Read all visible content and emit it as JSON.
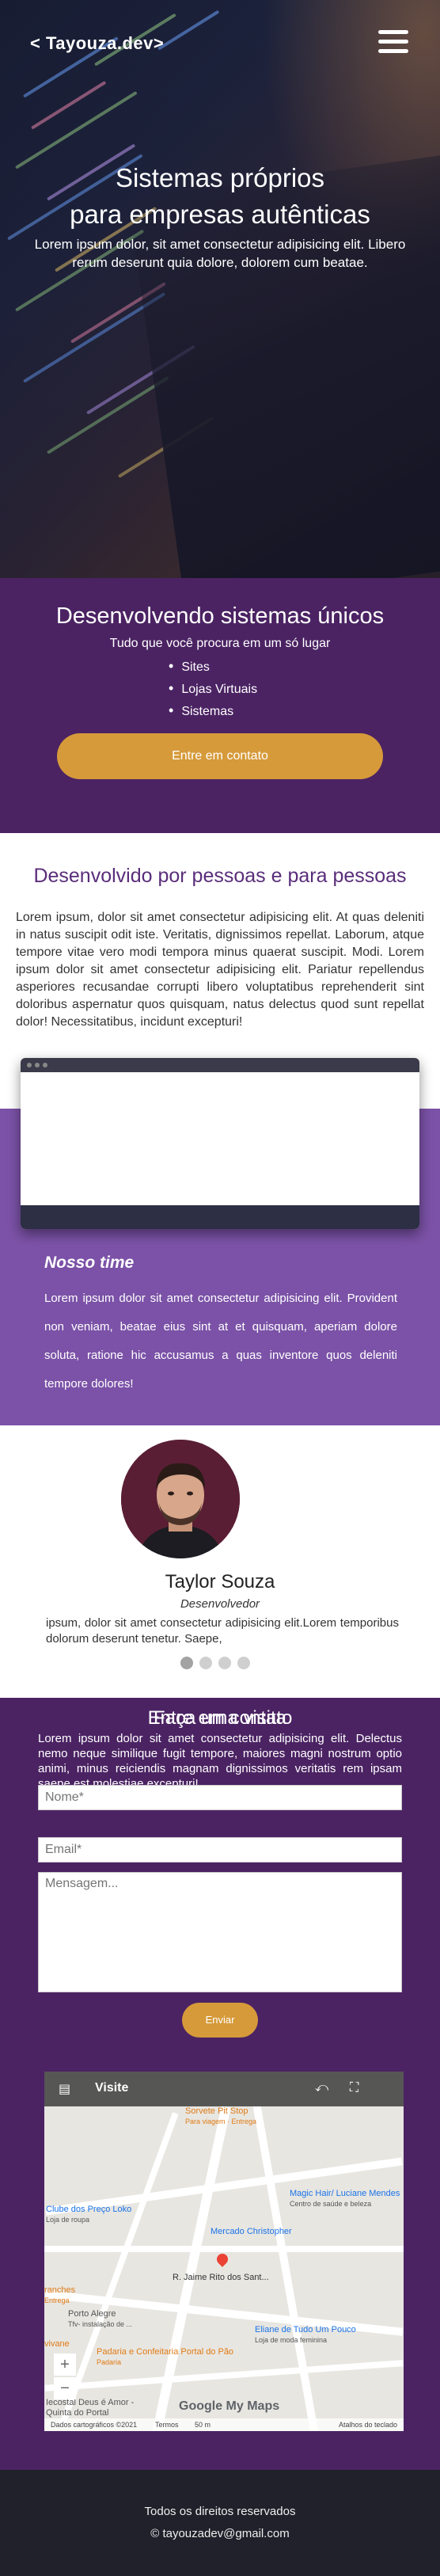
{
  "colors": {
    "purple_dark": "#4b2363",
    "purple_light": "#7b52a7",
    "accent": "#d69a3a",
    "footer": "#20212a"
  },
  "header": {
    "brand": "< Tayouza.dev>",
    "menu_icon": "hamburger-icon"
  },
  "hero": {
    "title_line1": "Sistemas próprios",
    "title_line2": "para empresas autênticas",
    "subtitle": "Lorem ipsum dolor, sit amet consectetur adipisicing elit. Libero rerum deserunt quia dolore, dolorem cum beatae."
  },
  "services": {
    "title": "Desenvolvendo sistemas únicos",
    "lead": "Tudo que você procura em um só lugar",
    "items": [
      "Sites",
      "Lojas Virtuais",
      "Sistemas"
    ],
    "cta": "Entre em contato"
  },
  "about": {
    "title": "Desenvolvido por pessoas e para pessoas",
    "text": "Lorem ipsum, dolor sit amet consectetur adipisicing elit. At quas deleniti in natus suscipit odit iste. Veritatis, dignissimos repellat. Laborum, atque tempore vitae vero modi tempora minus quaerat suscipit. Modi. Lorem ipsum dolor sit amet consectetur adipisicing elit. Pariatur repellendus asperiores recusandae corrupti libero voluptatibus reprehenderit sint doloribus aspernatur quos quisquam, natus delectus quod sunt repellat dolor! Necessitatibus, incidunt excepturi!"
  },
  "time": {
    "title": "Nosso time",
    "text": "Lorem ipsum dolor sit amet consectetur adipisicing elit. Provident non veniam, beatae eius sint at et quisquam, aperiam dolore soluta, ratione hic accusamus a quas inventore quos deleniti tempore dolores!"
  },
  "member": {
    "name": "Taylor Souza",
    "role": "Desenvolvedor",
    "quote": "ipsum, dolor sit amet consectetur adipisicing elit.Lorem temporibus dolorum deserunt tenetur. Saepe,"
  },
  "contact": {
    "title": "Entre em contato",
    "lead": "Lorem ipsum dolor sit amet consectetur adipisicing elit. Delectus nemo neque similique fugit tempore, maiores magni nostrum optio animi, minus reiciendis magnam dignissimos veritatis rem ipsam saepe est molestiae excepturi!",
    "name_placeholder": "Nome*",
    "email_placeholder": "Email*",
    "message_placeholder": "Mensagem...",
    "send": "Enviar",
    "visit_title": "Faça uma visita"
  },
  "map": {
    "label": "Visite",
    "pois": [
      "Clube dos Preço Loko",
      "Loja de roupa",
      "Magic Hair/ Luciane Mendes",
      "Centro de saúde e beleza",
      "Mercado Christopher",
      "R. Jaime Rito dos Sant...",
      "Porto Alegre",
      "Tfv- instalação de ...",
      "Eliane de Tudo Um Pouco",
      "Loja de moda feminina",
      "Padaria e Confeitaria Portal do Pão",
      "Padaria",
      "Iecostal Deus é Amor - Quinta do Portal",
      "Sorvete Pit Stop",
      "Para viagem · Entrega",
      "ranches",
      "Entrega",
      "vivane"
    ],
    "attribution": "Dados cartográficos ©2021",
    "terms": "Termos",
    "scale": "50 m",
    "shortcuts": "Atalhos do teclado",
    "logo": "Google My Maps"
  },
  "footer": {
    "rights": "Todos os direitos reservados",
    "email": "© tayouzadev@gmail.com"
  }
}
